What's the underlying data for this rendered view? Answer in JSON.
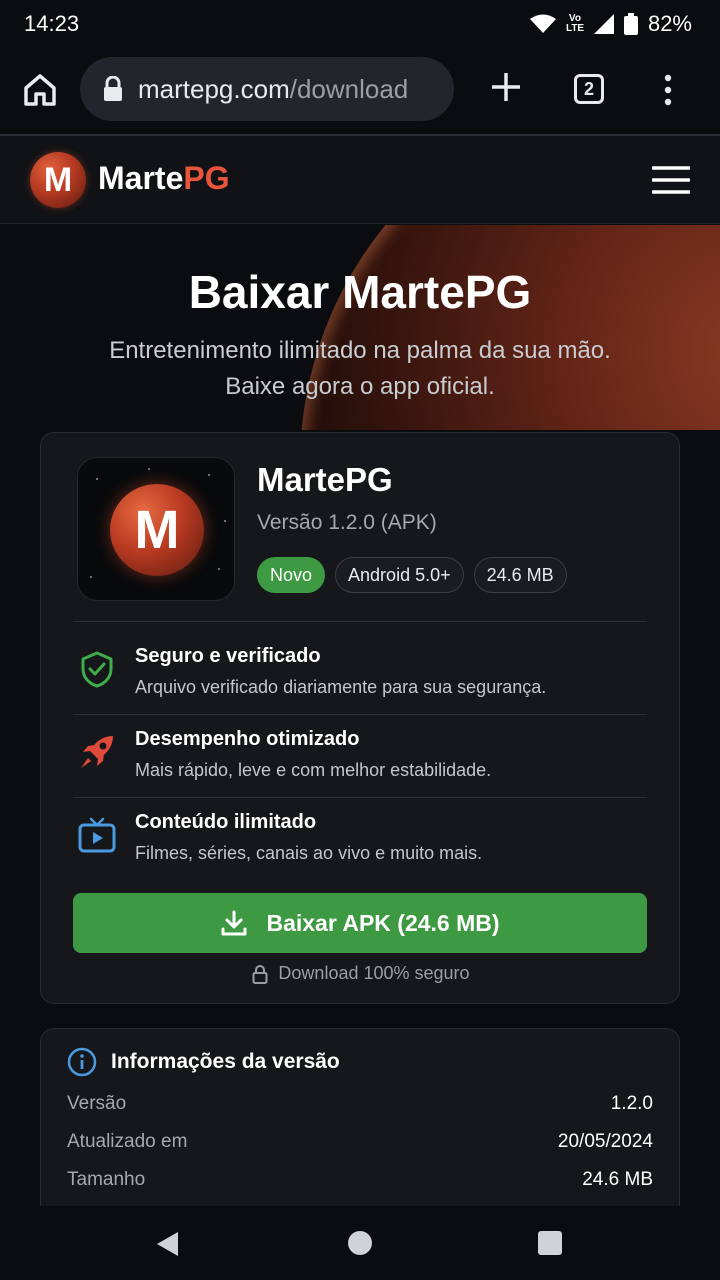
{
  "status_bar": {
    "time": "14:23",
    "battery": "82%",
    "network_label": "Vo LTE"
  },
  "browser": {
    "url_domain": "martepg.com",
    "url_path": "/download",
    "tab_count": "2"
  },
  "site": {
    "brand_main": "Marte",
    "brand_accent": "PG",
    "logo_letter": "M"
  },
  "hero": {
    "title": "Baixar MartePG",
    "subtitle_line1": "Entretenimento ilimitado na palma da sua mão.",
    "subtitle_line2": "Baixe agora o app oficial."
  },
  "app": {
    "icon_letter": "M",
    "name": "MartePG",
    "version": "Versão 1.2.0 (APK)",
    "chips": [
      "Novo",
      "Android 5.0+",
      "24.6 MB"
    ]
  },
  "features": [
    {
      "icon": "shield-check-icon",
      "title": "Seguro e verificado",
      "desc": "Arquivo verificado diariamente para sua segurança."
    },
    {
      "icon": "rocket-icon",
      "title": "Desempenho otimizado",
      "desc": "Mais rápido, leve e com melhor estabilidade."
    },
    {
      "icon": "tv-play-icon",
      "title": "Conteúdo ilimitado",
      "desc": "Filmes, séries, canais ao vivo e muito mais."
    }
  ],
  "download": {
    "button_label": "Baixar APK (24.6 MB)",
    "secure_note": "Download 100% seguro"
  },
  "info": {
    "title": "Informações da versão",
    "rows": [
      {
        "key": "Versão",
        "value": "1.2.0"
      },
      {
        "key": "Atualizado em",
        "value": "20/05/2024"
      },
      {
        "key": "Tamanho",
        "value": "24.6 MB"
      }
    ]
  },
  "colors": {
    "accent_red": "#e8553a",
    "accent_green": "#3d9a42",
    "background": "#0b0c0f"
  }
}
